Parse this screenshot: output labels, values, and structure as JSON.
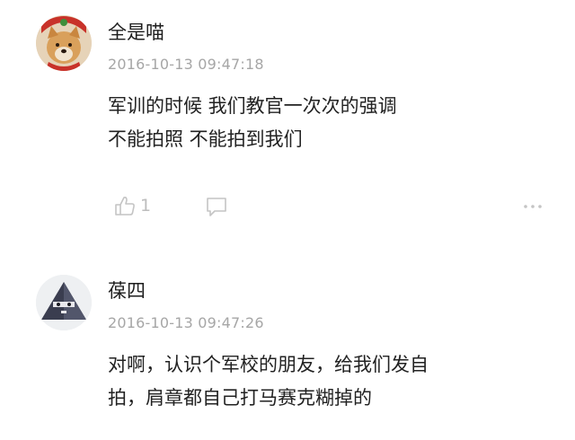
{
  "comments": [
    {
      "username": "全是喵",
      "timestamp": "2016-10-13 09:47:18",
      "lines": [
        "军训的时候 我们教官一次次的强调",
        "不能拍照 不能拍到我们"
      ],
      "likes": "1"
    },
    {
      "username": "葆四",
      "timestamp": "2016-10-13 09:47:26",
      "lines": [
        "对啊，认识个军校的朋友，给我们发自",
        "拍，肩章都自己打马赛克糊掉的"
      ]
    }
  ],
  "icons": {
    "like": "thumbs-up-icon",
    "reply": "comment-bubble-icon",
    "more": "more-dots-icon"
  },
  "colors": {
    "text": "#222222",
    "timestamp": "#a6a6a6",
    "icon": "#c4c4c4"
  }
}
